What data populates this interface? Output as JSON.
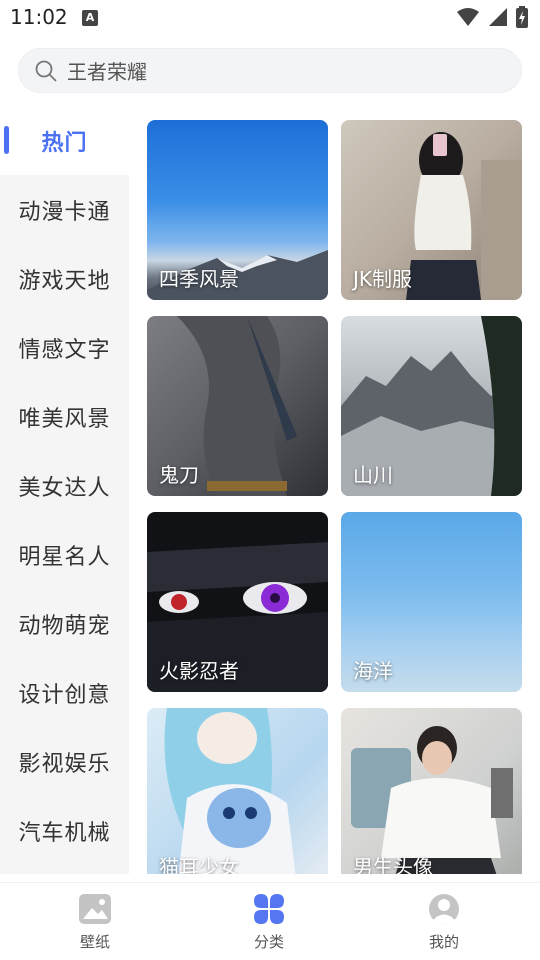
{
  "status_bar": {
    "time": "11:02",
    "notification_letter": "A",
    "icons": [
      "wifi-icon",
      "signal-icon",
      "battery-charging-icon"
    ]
  },
  "search": {
    "placeholder": "王者荣耀",
    "icon": "search-icon"
  },
  "sidebar": {
    "items": [
      {
        "label": "热门",
        "active": true
      },
      {
        "label": "动漫卡通"
      },
      {
        "label": "游戏天地"
      },
      {
        "label": "情感文字"
      },
      {
        "label": "唯美风景"
      },
      {
        "label": "美女达人"
      },
      {
        "label": "明星名人"
      },
      {
        "label": "动物萌宠"
      },
      {
        "label": "设计创意"
      },
      {
        "label": "影视娱乐"
      },
      {
        "label": "汽车机械"
      }
    ],
    "accent_color": "#4a72f2"
  },
  "categories": [
    {
      "label": "四季风景"
    },
    {
      "label": "JK制服"
    },
    {
      "label": "鬼刀"
    },
    {
      "label": "山川"
    },
    {
      "label": "火影忍者"
    },
    {
      "label": "海洋"
    },
    {
      "label": "猫耳少女"
    },
    {
      "label": "男生头像"
    }
  ],
  "bottom_nav": {
    "items": [
      {
        "label": "壁纸",
        "icon": "image-icon"
      },
      {
        "label": "分类",
        "icon": "grid-icon",
        "active": true
      },
      {
        "label": "我的",
        "icon": "user-icon"
      }
    ]
  }
}
